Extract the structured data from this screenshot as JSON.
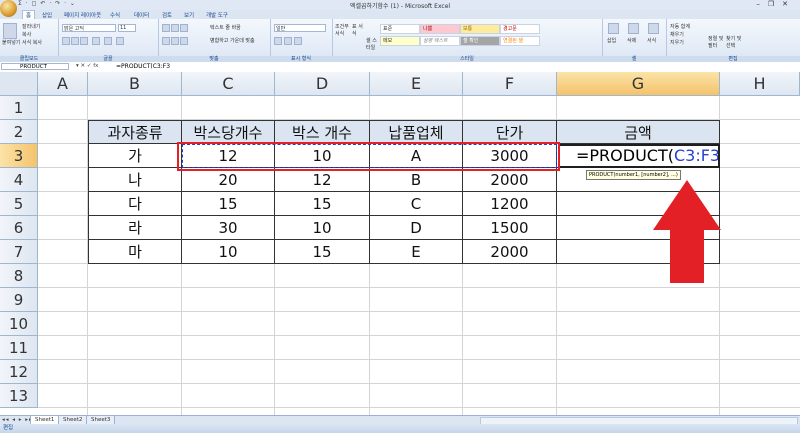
{
  "window": {
    "title": "엑셀곱하기함수 (1) - Microsoft Excel",
    "controls": [
      "–",
      "❐",
      "✕"
    ]
  },
  "quick_access": "Σ · ◻ ↶ · ↷ · ⌄",
  "ribbon": {
    "tabs": [
      "홈",
      "삽입",
      "페이지 레이아웃",
      "수식",
      "데이터",
      "검토",
      "보기",
      "개발 도구"
    ],
    "groups": [
      {
        "label": "클립보드",
        "items": [
          "붙여넣기",
          "잘라내기",
          "복사",
          "서식 복사"
        ]
      },
      {
        "label": "글꼴",
        "items": [
          "맑은 고딕",
          "11"
        ]
      },
      {
        "label": "맞춤",
        "items": [
          "텍스트 줄 바꿈",
          "병합하고 가운데 맞춤"
        ]
      },
      {
        "label": "표시 형식",
        "items": [
          "일반"
        ]
      },
      {
        "label": "스타일",
        "items": [
          "조건부 서식",
          "표 서식",
          "셀 스타일",
          "표준",
          "나쁨",
          "보통",
          "경고문",
          "메모",
          "설명 텍스트",
          "셀 확인",
          "연결된 셀"
        ]
      },
      {
        "label": "셀",
        "items": [
          "삽입",
          "삭제",
          "서식"
        ]
      },
      {
        "label": "편집",
        "items": [
          "자동 합계",
          "채우기",
          "지우기",
          "정렬 및 필터",
          "찾기 및 선택"
        ]
      }
    ]
  },
  "formula_bar": {
    "name_box": "PRODUCT",
    "buttons": "▾  ✕ ✓ fx",
    "formula": "=PRODUCT(C3:F3"
  },
  "columns": [
    "A",
    "B",
    "C",
    "D",
    "E",
    "F",
    "G",
    "H"
  ],
  "rows": [
    "1",
    "2",
    "3",
    "4",
    "5",
    "6",
    "7",
    "8",
    "9",
    "10",
    "11",
    "12",
    "13"
  ],
  "table": {
    "headers": [
      "과자종류",
      "박스당개수",
      "박스 개수",
      "납품업체",
      "단가",
      "금액"
    ],
    "data": [
      [
        "가",
        "12",
        "10",
        "A",
        "3000"
      ],
      [
        "나",
        "20",
        "12",
        "B",
        "2000"
      ],
      [
        "다",
        "15",
        "15",
        "C",
        "1200"
      ],
      [
        "라",
        "30",
        "10",
        "D",
        "1500"
      ],
      [
        "마",
        "10",
        "15",
        "E",
        "2000"
      ]
    ]
  },
  "active_cell": {
    "prefix": "=PRODUCT(",
    "ref": "C3:F3"
  },
  "tooltip": "PRODUCT(number1, [number2], ...)",
  "sheet_tabs": [
    "Sheet1",
    "Sheet2",
    "Sheet3"
  ],
  "sheet_nav": "◂◂ ◂ ▸ ▸▸",
  "status": "편집",
  "colors": {
    "red_highlight": "#e32025",
    "ref_blue": "#2b3fd1",
    "header_fill": "#dbe5f1"
  }
}
